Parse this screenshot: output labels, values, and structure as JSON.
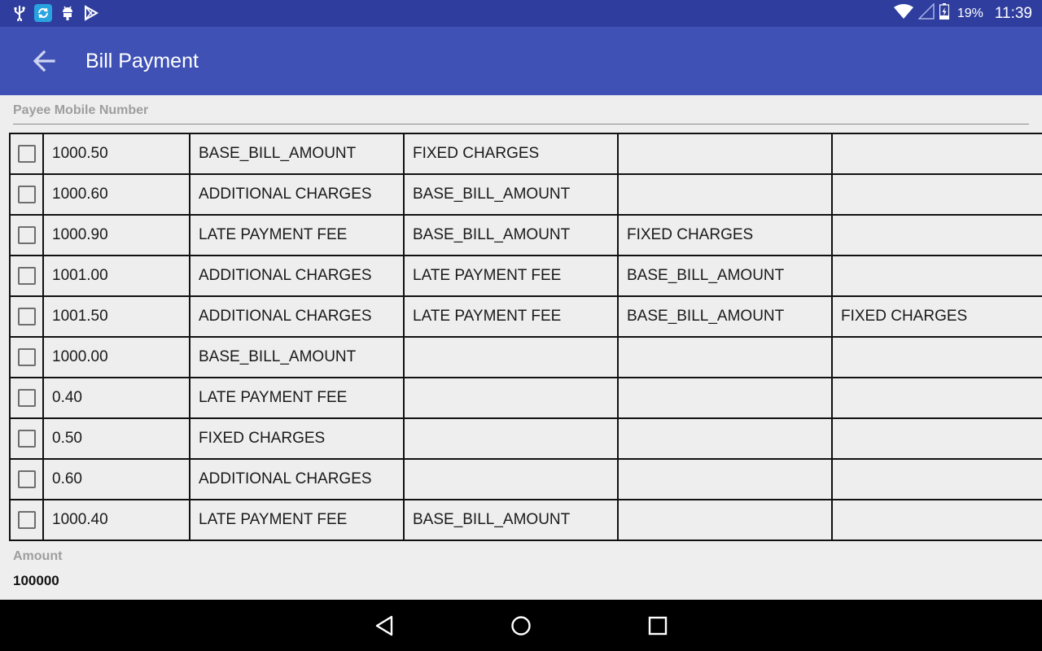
{
  "status_bar": {
    "icons": [
      "usb-icon",
      "sync-app-icon",
      "android-debug-icon",
      "play-store-icon",
      "wifi-icon",
      "signal-icon",
      "battery-charging-icon"
    ],
    "battery": "19%",
    "time": "11:39"
  },
  "app_bar": {
    "title": "Bill Payment",
    "back_icon": "arrow-left-icon"
  },
  "payee": {
    "label": "Payee Mobile Number",
    "value": ""
  },
  "bill_table": {
    "rows": [
      {
        "checked": false,
        "amount": "1000.50",
        "c1": "BASE_BILL_AMOUNT",
        "c2": "FIXED CHARGES",
        "c3": "",
        "c4": ""
      },
      {
        "checked": false,
        "amount": "1000.60",
        "c1": "ADDITIONAL CHARGES",
        "c2": "BASE_BILL_AMOUNT",
        "c3": "",
        "c4": ""
      },
      {
        "checked": false,
        "amount": "1000.90",
        "c1": "LATE PAYMENT FEE",
        "c2": "BASE_BILL_AMOUNT",
        "c3": "FIXED CHARGES",
        "c4": ""
      },
      {
        "checked": false,
        "amount": "1001.00",
        "c1": "ADDITIONAL CHARGES",
        "c2": "LATE PAYMENT FEE",
        "c3": "BASE_BILL_AMOUNT",
        "c4": ""
      },
      {
        "checked": false,
        "amount": "1001.50",
        "c1": "ADDITIONAL CHARGES",
        "c2": "LATE PAYMENT FEE",
        "c3": "BASE_BILL_AMOUNT",
        "c4": "FIXED CHARGES"
      },
      {
        "checked": false,
        "amount": "1000.00",
        "c1": "BASE_BILL_AMOUNT",
        "c2": "",
        "c3": "",
        "c4": ""
      },
      {
        "checked": false,
        "amount": "0.40",
        "c1": "LATE PAYMENT FEE",
        "c2": "",
        "c3": "",
        "c4": ""
      },
      {
        "checked": false,
        "amount": "0.50",
        "c1": "FIXED CHARGES",
        "c2": "",
        "c3": "",
        "c4": ""
      },
      {
        "checked": false,
        "amount": "0.60",
        "c1": "ADDITIONAL CHARGES",
        "c2": "",
        "c3": "",
        "c4": ""
      },
      {
        "checked": false,
        "amount": "1000.40",
        "c1": "LATE PAYMENT FEE",
        "c2": "BASE_BILL_AMOUNT",
        "c3": "",
        "c4": ""
      }
    ]
  },
  "amount": {
    "label": "Amount",
    "value": "100000"
  },
  "nav_bar": {
    "buttons": [
      "nav-back-icon",
      "nav-home-icon",
      "nav-recents-icon"
    ]
  },
  "colors": {
    "status_bar": "#2f3e9e",
    "app_bar": "#3f51b5",
    "background": "#eeeeee"
  }
}
